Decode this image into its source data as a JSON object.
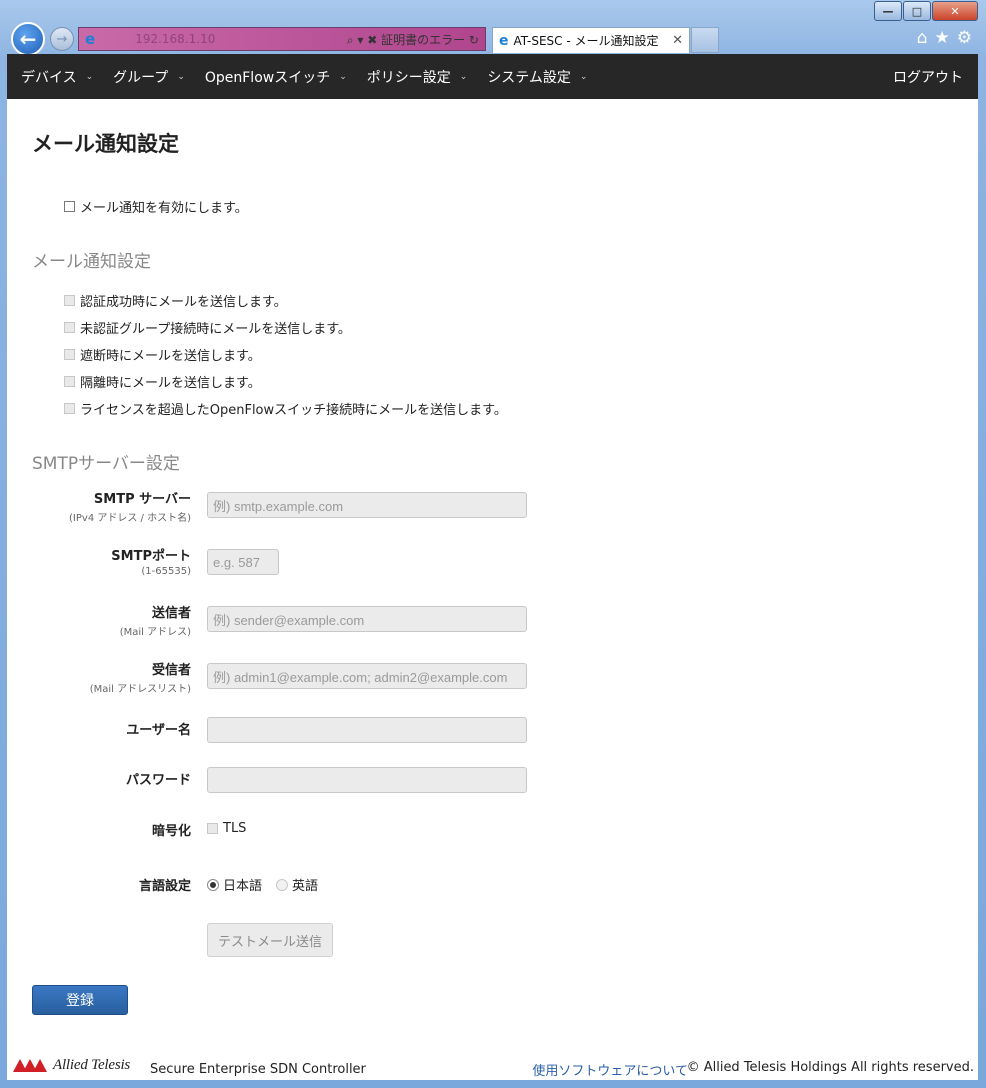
{
  "browser": {
    "address_text": "192.168.1.10",
    "address_controls": "⌕ ▾ ✖ 証明書のエラー ↻",
    "tab_title": "AT-SESC - メール通知設定",
    "tab_close": "✕"
  },
  "navbar": {
    "items": [
      {
        "label": "デバイス"
      },
      {
        "label": "グループ"
      },
      {
        "label": "OpenFlowスイッチ"
      },
      {
        "label": "ポリシー設定"
      },
      {
        "label": "システム設定"
      }
    ],
    "logout": "ログアウト"
  },
  "page": {
    "title": "メール通知設定",
    "enable_label": "メール通知を有効にします。",
    "notify_section": "メール通知設定",
    "notify_options": [
      "認証成功時にメールを送信します。",
      "未認証グループ接続時にメールを送信します。",
      "遮断時にメールを送信します。",
      "隔離時にメールを送信します。",
      "ライセンスを超過したOpenFlowスイッチ接続時にメールを送信します。"
    ],
    "smtp_section": "SMTPサーバー設定",
    "fields": {
      "server": {
        "label": "SMTP サーバー",
        "sub": "(IPv4 アドレス / ホスト名)",
        "placeholder": "例) smtp.example.com"
      },
      "port": {
        "label": "SMTPポート",
        "sub": "(1-65535)",
        "placeholder": "e.g. 587"
      },
      "sender": {
        "label": "送信者",
        "sub": "(Mail アドレス)",
        "placeholder": "例) sender@example.com"
      },
      "recipient": {
        "label": "受信者",
        "sub": "(Mail アドレスリスト)",
        "placeholder": "例) admin1@example.com; admin2@example.com"
      },
      "username": {
        "label": "ユーザー名",
        "value": ""
      },
      "password": {
        "label": "パスワード",
        "value": ""
      },
      "encryption": {
        "label": "暗号化",
        "option": "TLS"
      },
      "language": {
        "label": "言語設定",
        "options": [
          "日本語",
          "英語"
        ],
        "selected": "日本語"
      }
    },
    "test_button": "テストメール送信",
    "submit_button": "登録"
  },
  "footer": {
    "logo_text": "Allied Telesis",
    "product": "Secure Enterprise SDN Controller",
    "about_link": "使用ソフトウェアについて",
    "copyright": "© Allied Telesis Holdings All rights reserved."
  },
  "colors": {
    "navbar_bg": "#272727",
    "primary_button": "#2d68b0",
    "link": "#2a5fa8",
    "logo_red": "#d01f26"
  },
  "icons": [
    "back-arrow-icon",
    "forward-arrow-icon",
    "ie-logo-icon",
    "home-icon",
    "star-icon",
    "gear-icon",
    "close-icon",
    "caret-down-icon"
  ]
}
